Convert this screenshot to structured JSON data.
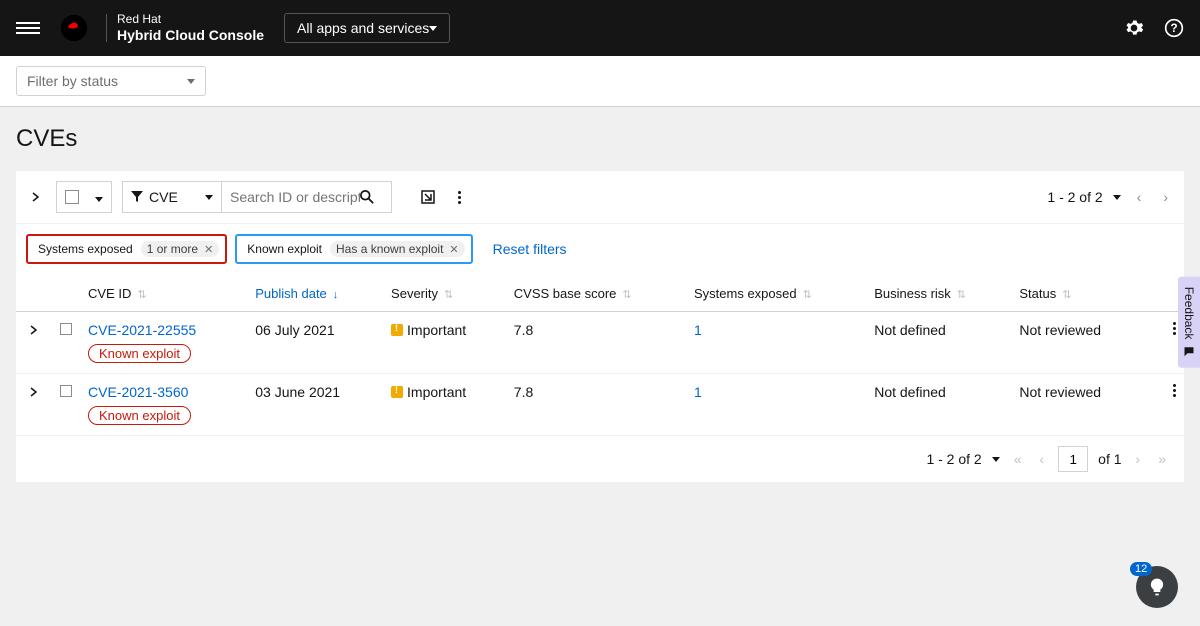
{
  "header": {
    "brand_line1": "Red Hat",
    "brand_line2": "Hybrid Cloud Console",
    "app_selector": "All apps and services"
  },
  "subbar": {
    "filter_placeholder": "Filter by status"
  },
  "page": {
    "title": "CVEs"
  },
  "toolbar": {
    "filter_type": "CVE",
    "search_placeholder": "Search ID or description",
    "pager_text": "1 - 2 of 2"
  },
  "chips": {
    "systems_exposed_label": "Systems exposed",
    "systems_exposed_value": "1 or more",
    "known_exploit_label": "Known exploit",
    "known_exploit_value": "Has a known exploit",
    "reset": "Reset filters"
  },
  "columns": {
    "cve_id": "CVE ID",
    "publish_date": "Publish date",
    "severity": "Severity",
    "cvss": "CVSS base score",
    "systems_exposed": "Systems exposed",
    "business_risk": "Business risk",
    "status": "Status"
  },
  "rows": [
    {
      "cve": "CVE-2021-22555",
      "badge": "Known exploit",
      "publish": "06 July 2021",
      "severity": "Important",
      "cvss": "7.8",
      "systems": "1",
      "risk": "Not defined",
      "status": "Not reviewed"
    },
    {
      "cve": "CVE-2021-3560",
      "badge": "Known exploit",
      "publish": "03 June 2021",
      "severity": "Important",
      "cvss": "7.8",
      "systems": "1",
      "risk": "Not defined",
      "status": "Not reviewed"
    }
  ],
  "bottom_pager": {
    "range_text": "1 - 2 of 2",
    "page_input": "1",
    "of_text": "of 1"
  },
  "feedback": {
    "label": "Feedback"
  },
  "bubble": {
    "count": "12"
  }
}
